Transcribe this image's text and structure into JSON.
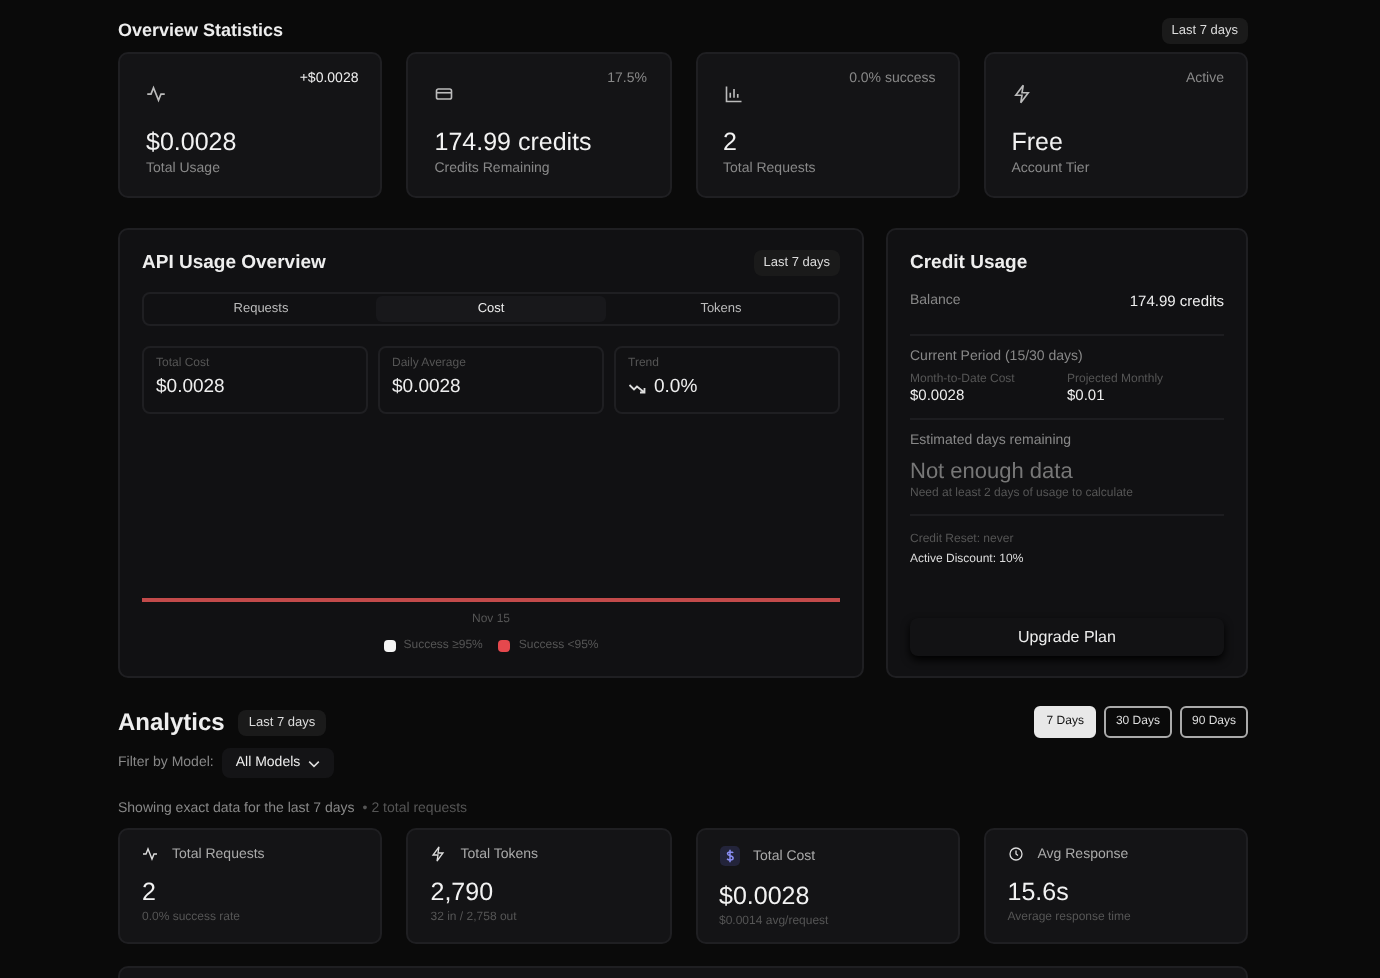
{
  "overview": {
    "title": "Overview Statistics",
    "range": "Last 7 days",
    "cards": [
      {
        "kind": "pulse",
        "badge": "+$0.0028",
        "badge_bright": true,
        "value": "$0.0028",
        "label": "Total Usage"
      },
      {
        "kind": "card",
        "badge": "17.5%",
        "badge_bright": false,
        "value": "174.99 credits",
        "label": "Credits Remaining"
      },
      {
        "kind": "bars",
        "badge": "0.0% success",
        "badge_bright": false,
        "value": "2",
        "label": "Total Requests"
      },
      {
        "kind": "zap",
        "badge": "Active",
        "badge_bright": false,
        "value": "Free",
        "label": "Account Tier"
      }
    ]
  },
  "api_usage": {
    "title": "API Usage Overview",
    "range": "Last 7 days",
    "tabs": [
      {
        "label": "Requests",
        "selected": false
      },
      {
        "label": "Cost",
        "selected": true
      },
      {
        "label": "Tokens",
        "selected": false
      }
    ],
    "stats": [
      {
        "label": "Total Cost",
        "value": "$0.0028",
        "trend": false
      },
      {
        "label": "Daily Average",
        "value": "$0.0028",
        "trend": false
      },
      {
        "label": "Trend",
        "value": "0.0%",
        "trend": true
      }
    ],
    "x_label": "Nov 15",
    "legend": [
      {
        "label": "Success ≥95%",
        "color": "#f5f5f5"
      },
      {
        "label": "Success <95%",
        "color": "#e5484d"
      }
    ]
  },
  "credit_usage": {
    "title": "Credit Usage",
    "balance_label": "Balance",
    "balance": "174.99 credits",
    "period": "Current Period (15/30 days)",
    "mtd_label": "Month-to-Date Cost",
    "mtd": "$0.0028",
    "projected_label": "Projected Monthly",
    "projected": "$0.01",
    "estimate_label": "Estimated days remaining",
    "estimate": "Not enough data",
    "estimate_note": "Need at least 2 days of usage to calculate",
    "reset": "Credit Reset: never",
    "discount": "Active Discount: 10%",
    "button": "Upgrade Plan"
  },
  "analytics": {
    "title": "Analytics",
    "range": "Last 7 days",
    "ranges": [
      {
        "label": "7 Days",
        "selected": true
      },
      {
        "label": "30 Days",
        "selected": false
      },
      {
        "label": "90 Days",
        "selected": false
      }
    ],
    "filter_label": "Filter by Model:",
    "filter_value": "All Models",
    "summary": "Showing exact data for the last 7 days",
    "summary_count": "• 2 total requests",
    "cards": [
      {
        "kind": "pulse",
        "title": "Total Requests",
        "value": "2",
        "note": "0.0% success rate"
      },
      {
        "kind": "zap",
        "title": "Total Tokens",
        "value": "2,790",
        "note": "32 in / 2,758 out"
      },
      {
        "kind": "dollar",
        "title": "Total Cost",
        "value": "$0.0028",
        "note": "$0.0014 avg/request"
      },
      {
        "kind": "clock",
        "title": "Avg Response",
        "value": "15.6s",
        "note": "Average response time"
      }
    ]
  }
}
